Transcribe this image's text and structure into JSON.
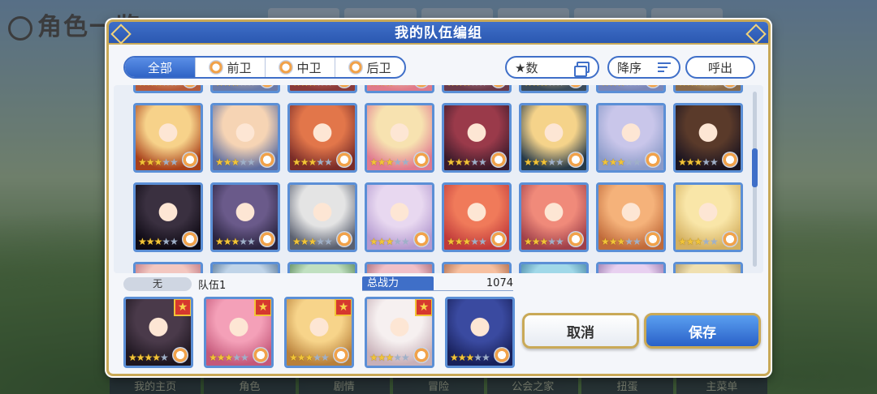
{
  "background": {
    "title": "角色一览",
    "bottom_nav": [
      "我的主页",
      "角色",
      "剧情",
      "冒险",
      "公会之家",
      "扭蛋",
      "主菜单"
    ]
  },
  "dialog": {
    "title": "我的队伍编组",
    "tabs": [
      {
        "label": "全部",
        "active": true
      },
      {
        "label": "前卫",
        "active": false
      },
      {
        "label": "中卫",
        "active": false
      },
      {
        "label": "后卫",
        "active": false
      }
    ],
    "sort_stat_label": "★数",
    "sort_order_label": "降序",
    "call_label": "呼出"
  },
  "colors": {
    "accent": "#3f6fc8",
    "gold": "#c9a957",
    "star": "#f2c438",
    "leader_badge": "#d6382e"
  },
  "roster": {
    "top_partial_row": [
      {
        "stars": 3,
        "color_a": "#f7d28a",
        "color_b": "#b55a3a"
      },
      {
        "stars": 3,
        "color_a": "#f0c9a0",
        "color_b": "#6a7aa8"
      },
      {
        "stars": 3,
        "color_a": "#e98a6a",
        "color_b": "#8a3a3a"
      },
      {
        "stars": 3,
        "color_a": "#f7e0a8",
        "color_b": "#e07a8a"
      },
      {
        "stars": 3,
        "color_a": "#d59aa0",
        "color_b": "#6a3a4a"
      },
      {
        "stars": 3,
        "color_a": "#f5d38a",
        "color_b": "#3a4a5a"
      },
      {
        "stars": 3,
        "color_a": "#c6c8e8",
        "color_b": "#7a86b8"
      },
      {
        "stars": 3,
        "color_a": "#f7e3a0",
        "color_b": "#8a6a4a"
      }
    ],
    "rows": [
      [
        {
          "stars": 3,
          "color_a": "#f7d28a",
          "color_b": "#a8401a"
        },
        {
          "stars": 3,
          "color_a": "#f6d4b4",
          "color_b": "#5d6da0"
        },
        {
          "stars": 3,
          "color_a": "#e2764a",
          "color_b": "#7a2c28"
        },
        {
          "stars": 3,
          "color_a": "#f7e2b0",
          "color_b": "#e07a90"
        },
        {
          "stars": 3,
          "color_a": "#9a3a4a",
          "color_b": "#3a1a2a"
        },
        {
          "stars": 3,
          "color_a": "#f5d38a",
          "color_b": "#263a4a"
        },
        {
          "stars": 3,
          "color_a": "#c9c6ea",
          "color_b": "#8a9ac8"
        },
        {
          "stars": 3,
          "color_a": "#5a3a2a",
          "color_b": "#1a1420"
        }
      ],
      [
        {
          "stars": 3,
          "color_a": "#3a3040",
          "color_b": "#0e0a14"
        },
        {
          "stars": 3,
          "color_a": "#6a5a8a",
          "color_b": "#2a2440"
        },
        {
          "stars": 3,
          "color_a": "#e4e4e4",
          "color_b": "#5a6070"
        },
        {
          "stars": 3,
          "color_a": "#e8d8f0",
          "color_b": "#b49ad0"
        },
        {
          "stars": 3,
          "color_a": "#f07a5a",
          "color_b": "#c03a3a"
        },
        {
          "stars": 3,
          "color_a": "#f08a7a",
          "color_b": "#a0404a"
        },
        {
          "stars": 3,
          "color_a": "#f5b27a",
          "color_b": "#c06a3a"
        },
        {
          "stars": 3,
          "color_a": "#f9e6a8",
          "color_b": "#d4b060"
        }
      ]
    ],
    "bottom_partial_row": [
      {
        "stars": 3,
        "color_a": "#f3c7c0",
        "color_b": "#b66a7a"
      },
      {
        "stars": 3,
        "color_a": "#c0d4e8",
        "color_b": "#4a6a8a"
      },
      {
        "stars": 3,
        "color_a": "#c0e0c0",
        "color_b": "#4a7a4a"
      },
      {
        "stars": 3,
        "color_a": "#f0c0c8",
        "color_b": "#9a5a6a"
      },
      {
        "stars": 3,
        "color_a": "#f7c0a0",
        "color_b": "#a05a3a"
      },
      {
        "stars": 3,
        "color_a": "#a0d8e8",
        "color_b": "#3a7a9a"
      },
      {
        "stars": 3,
        "color_a": "#e8d0f0",
        "color_b": "#8a6aa0"
      },
      {
        "stars": 3,
        "color_a": "#f0e0b0",
        "color_b": "#a08a5a"
      }
    ]
  },
  "party": {
    "none_label": "无",
    "name": "队伍1",
    "power_label": "总战力",
    "power_value": "1074",
    "members": [
      {
        "stars": 4,
        "leader": true,
        "color_a": "#4a3a4a",
        "color_b": "#1e1620"
      },
      {
        "stars": 3,
        "leader": true,
        "color_a": "#f4a0b8",
        "color_b": "#c4587a"
      },
      {
        "stars": 3,
        "leader": true,
        "color_a": "#f7d48a",
        "color_b": "#b8803a"
      },
      {
        "stars": 3,
        "leader": true,
        "color_a": "#f6f0f0",
        "color_b": "#c8b0b8"
      },
      {
        "stars": 3,
        "leader": false,
        "color_a": "#3a4aa0",
        "color_b": "#18205a"
      }
    ],
    "cancel_label": "取消",
    "save_label": "保存"
  }
}
